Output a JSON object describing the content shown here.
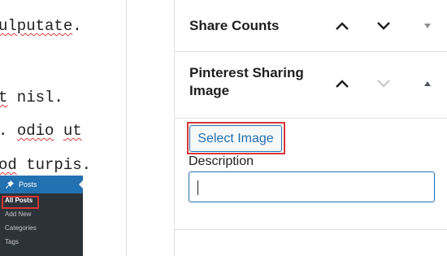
{
  "editor": {
    "lines": [
      {
        "plain": "",
        "squiggle": "ulputate",
        "after": "."
      },
      {
        "plain": "",
        "squiggle": "t",
        "after": " nisl."
      },
      {
        "plain": ". ",
        "squiggle": "odio",
        "after": " ",
        "squiggle2": "ut"
      },
      {
        "plain": "",
        "squiggle": "od",
        "after": " turpis."
      }
    ]
  },
  "wp_menu": {
    "header": "Posts",
    "items": [
      "All Posts",
      "Add New",
      "Categories",
      "Tags"
    ]
  },
  "sidebar": {
    "share_counts_title": "Share Counts",
    "pinterest_title_line1": "Pinterest Sharing",
    "pinterest_title_line2": "Image",
    "select_image_label": "Select Image",
    "description_label": "Description",
    "description_value": ""
  },
  "icons": {
    "up": "chevron-up-icon",
    "down": "chevron-down-icon",
    "toggle": "caret-icon"
  },
  "colors": {
    "accent": "#2271b1",
    "highlight": "#d63638",
    "admin_bg": "#1d2327"
  }
}
